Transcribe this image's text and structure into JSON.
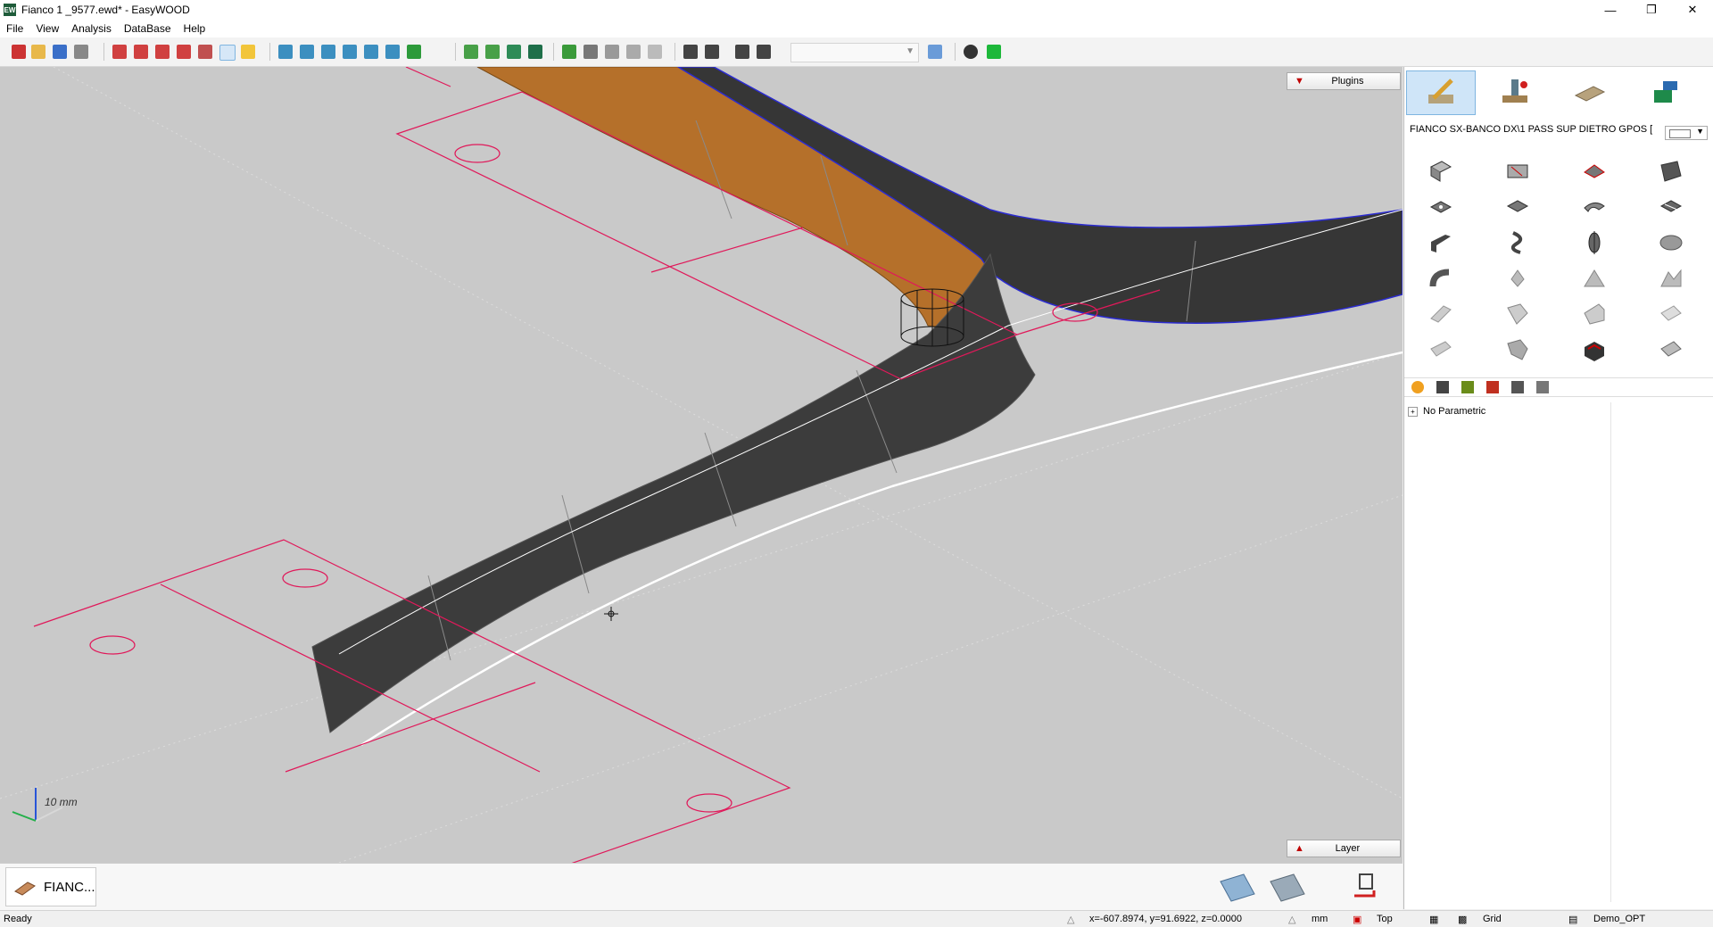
{
  "window": {
    "title": "Fianco 1 _9577.ewd* - EasyWOOD",
    "app_icon_text": "EW",
    "controls": [
      "minimize-icon",
      "maximize-icon",
      "close-icon"
    ]
  },
  "menu": [
    "File",
    "View",
    "Analysis",
    "DataBase",
    "Help"
  ],
  "toolbar": {
    "icons": [
      "new-icon",
      "open-icon",
      "save-icon",
      "print-icon",
      "zoom-window-icon",
      "zoom-in-icon",
      "zoom-out-icon",
      "zoom-extents-icon",
      "pan-icon",
      "redraw-icon",
      "light-icon",
      "view-front-icon",
      "view-back-icon",
      "view-left-icon",
      "view-right-icon",
      "view-top-icon",
      "view-iso-icon",
      "view-rotate-icon",
      "shade-wire-icon",
      "shade-hidden-icon",
      "shade-solid-icon",
      "shade-render-icon",
      "snap-icon",
      "measure-icon",
      "section-icon",
      "properties-icon",
      "undo-icon",
      "redo-icon",
      "copy-icon",
      "user-icon",
      "status-icon"
    ],
    "combo_value": ""
  },
  "viewport": {
    "plugins_label": "Plugins",
    "layer_label": "Layer",
    "axis_label": "10 mm"
  },
  "right_panel": {
    "top_tabs": [
      "sketch-tool-icon",
      "machining-icon",
      "panel-icon",
      "export-icon"
    ],
    "object_path": "FIANCO SX-BANCO DX\\1 PASS SUP DIETRO GPOS [",
    "color_value": "white",
    "tool_grid": [
      "extrude-surface-icon",
      "loft-surface-icon",
      "sweep-surface-icon",
      "ruled-surface-icon",
      "planar-surface-icon",
      "offset-surface-icon",
      "fillet-surface-icon",
      "split-surface-icon",
      "profile-bend-icon",
      "twist-icon",
      "revolve-icon",
      "ellipse-surface-icon",
      "pipe-icon",
      "point-icon",
      "network-icon",
      "blend-icon",
      "trim-icon",
      "extend-icon",
      "join-icon",
      "cut-icon",
      "flip-icon",
      "unroll-icon",
      "box-icon",
      "patch-icon"
    ],
    "tool_tabs": [
      "favorites-icon",
      "curve-icon",
      "surface-icon",
      "info-icon",
      "dimension-icon",
      "hand-icon"
    ],
    "tree_label": "No Parametric"
  },
  "bottom": {
    "file_tab": "FIANC...",
    "icons": [
      "top-panel-icon",
      "bottom-panel-icon",
      "layer-move-icon"
    ]
  },
  "status": {
    "ready": "Ready",
    "coords": "x=-607.8974, y=91.6922, z=0.0000",
    "units": "mm",
    "view": "Top",
    "grid": "Grid",
    "profile": "Demo_OPT"
  },
  "colors": {
    "viewport_bg": "#c9c9c9",
    "profile_lines": "#e0195a",
    "edge_lines": "#3333cc",
    "surface_dark": "#3c3c3c",
    "surface_wood": "#b5702a",
    "active_tab": "#cfe5f8"
  }
}
